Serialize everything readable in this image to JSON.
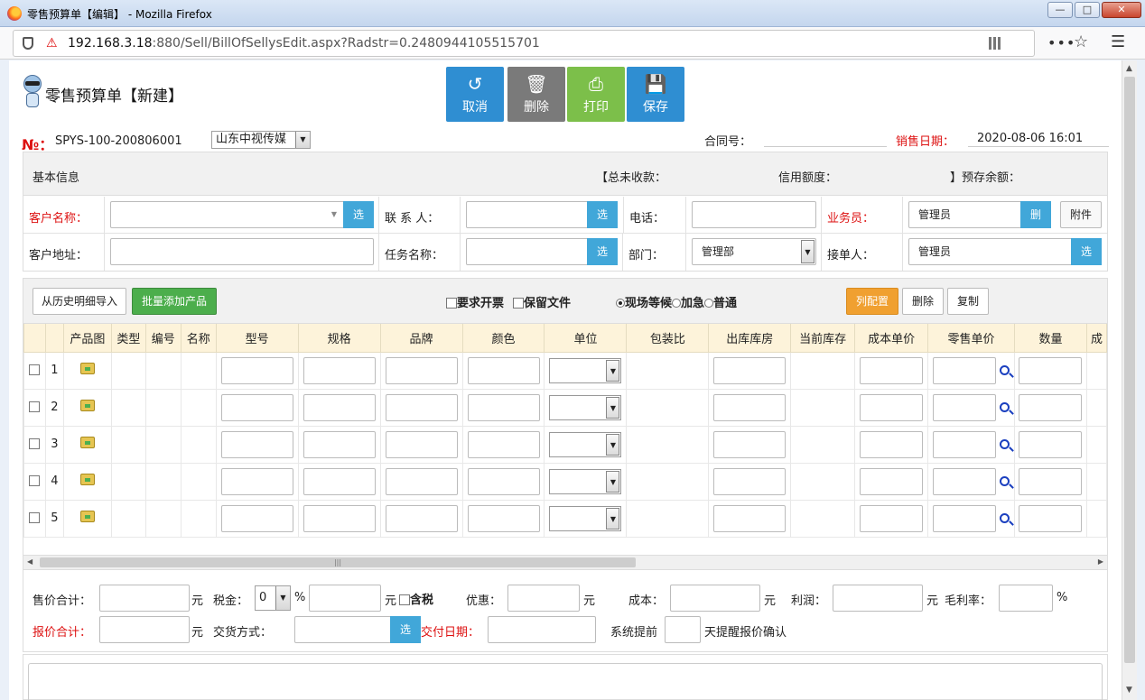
{
  "window": {
    "title": "零售预算单【编辑】 - Mozilla Firefox",
    "url_host": "192.168.3.18",
    "url_rest": ":880/Sell/BillOfSellysEdit.aspx?Radstr=0.2480944105515701"
  },
  "page": {
    "title": "零售预算单【新建】",
    "toolbar": {
      "cancel": "取消",
      "delete": "删除",
      "print": "打印",
      "save": "保存"
    },
    "no_label": "№：",
    "no_value": "SPYS-100-200806001",
    "company": "山东中视传媒",
    "contract_label": "合同号：",
    "contract_value": "",
    "sale_date_label": "销售日期：",
    "sale_date_value": "2020-08-06 16:01"
  },
  "basic": {
    "header": "基本信息",
    "total_unpaid_label": "【总未收款：",
    "credit_label": "信用额度：",
    "prepaid_label": "】预存余额：",
    "customer_label": "客户名称：",
    "contact_label": "联 系 人：",
    "phone_label": "电话：",
    "salesman_label": "业务员：",
    "salesman_value": "管理员",
    "address_label": "客户地址：",
    "task_label": "任务名称：",
    "dept_label": "部门：",
    "dept_value": "管理部",
    "receiver_label": "接单人：",
    "receiver_value": "管理员",
    "select_btn": "选",
    "delete_btn": "删",
    "attach_btn": "附件"
  },
  "products": {
    "import_history": "从历史明细导入",
    "batch_add": "批量添加产品",
    "invoice_label": "要求开票",
    "keep_file_label": "保留文件",
    "urgency": [
      "现场等候",
      "加急",
      "普通"
    ],
    "col_config": "列配置",
    "delete": "删除",
    "copy": "复制",
    "columns": [
      "",
      "",
      "产品图",
      "类型",
      "编号",
      "名称",
      "型号",
      "规格",
      "品牌",
      "颜色",
      "单位",
      "包装比",
      "出库库房",
      "当前库存",
      "成本单价",
      "零售单价",
      "数量",
      "成"
    ],
    "rows": [
      "1",
      "2",
      "3",
      "4",
      "5"
    ]
  },
  "summary": {
    "sale_total_label": "售价合计：",
    "yuan": "元",
    "tax_label": "税金：",
    "tax_value": "0",
    "percent": "%",
    "tax_included": "含税",
    "discount_label": "优惠：",
    "cost_label": "成本：",
    "profit_label": "利润：",
    "margin_label": "毛利率：",
    "quote_total_label": "报价合计：",
    "delivery_method_label": "交货方式：",
    "select_btn": "选",
    "delivery_date_label": "交付日期：",
    "remind_prefix": "系统提前",
    "remind_suffix": "天提醒报价确认"
  },
  "colors": {
    "accent_blue": "#2f8ed2",
    "select_blue": "#41a7d9",
    "required_red": "#d11111",
    "green": "#4cae4c",
    "orange": "#f0a030",
    "table_header": "#fdf3da"
  }
}
